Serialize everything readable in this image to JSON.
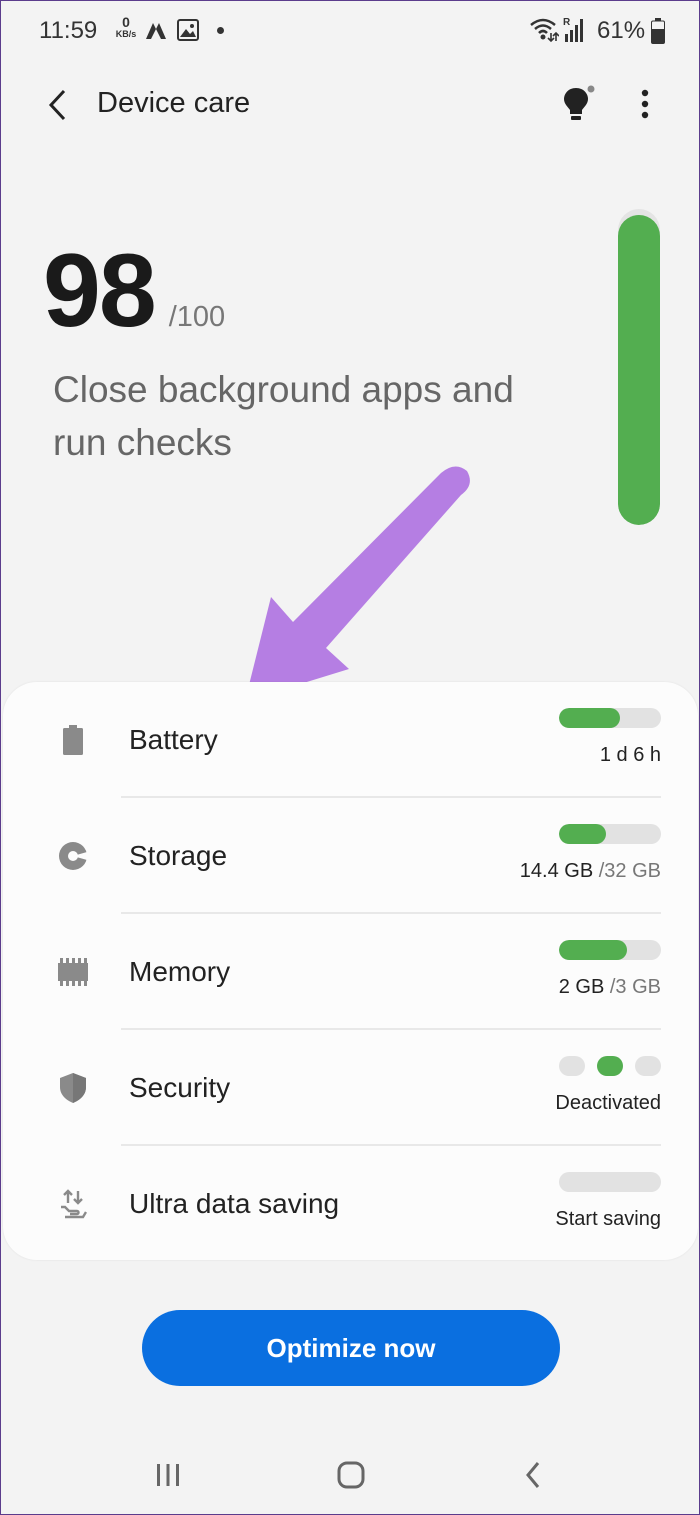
{
  "status_bar": {
    "time": "11:59",
    "net_speed_value": "0",
    "net_speed_unit": "KB/s",
    "battery_percent": "61%",
    "icons": [
      "data-saver-icon",
      "gallery-icon",
      "notification-dot-icon",
      "wifi-icon",
      "signal-icon",
      "battery-icon"
    ]
  },
  "app_bar": {
    "title": "Device care",
    "icons": [
      "back-icon",
      "lightbulb-icon",
      "more-vert-icon"
    ]
  },
  "score": {
    "value": "98",
    "max": "/100",
    "description": "Close background apps and run checks",
    "gauge_fraction": 0.98,
    "gauge_color": "#53ae50"
  },
  "items": [
    {
      "label": "Battery",
      "icon": "battery-icon",
      "meter_fraction": 0.6,
      "value": "1 d 6 h",
      "value_of": ""
    },
    {
      "label": "Storage",
      "icon": "storage-pie-icon",
      "meter_fraction": 0.46,
      "value": "14.4 GB",
      "value_of": "/32 GB"
    },
    {
      "label": "Memory",
      "icon": "memory-chip-icon",
      "meter_fraction": 0.67,
      "value": "2 GB",
      "value_of": "/3 GB"
    },
    {
      "label": "Security",
      "icon": "shield-icon",
      "value": "Deactivated",
      "value_of": ""
    },
    {
      "label": "Ultra data saving",
      "icon": "data-saving-icon",
      "meter_fraction": 0,
      "value": "Start saving",
      "value_of": ""
    }
  ],
  "optimize_button": {
    "label": "Optimize now",
    "color": "#0a6fe0"
  },
  "nav_bar": {
    "icons": [
      "recents-icon",
      "home-icon",
      "back-nav-icon"
    ]
  },
  "colors": {
    "accent_green": "#53ae50",
    "annotation_arrow": "#b57ee3"
  }
}
